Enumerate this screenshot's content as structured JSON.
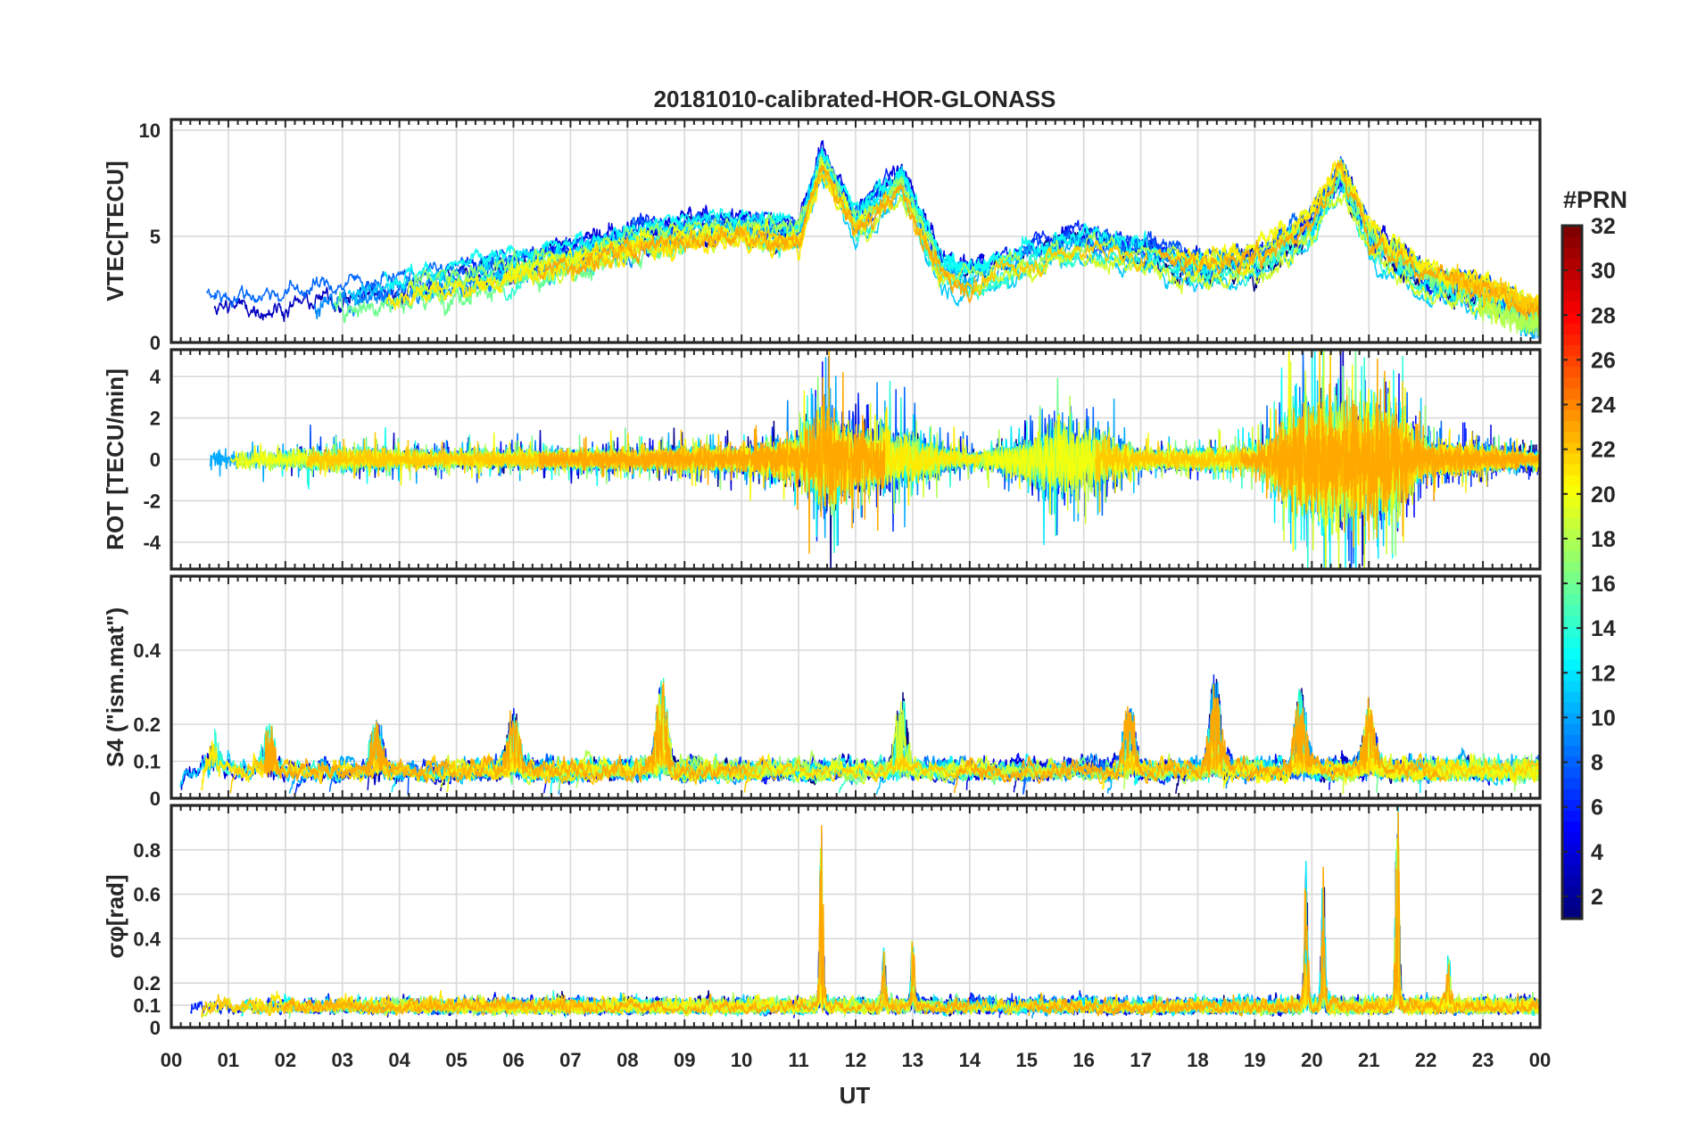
{
  "title": "20181010-calibrated-HOR-GLONASS",
  "chart_data": {
    "type": "line",
    "title": "20181010-calibrated-HOR-GLONASS",
    "xlabel": "UT",
    "xlim": [
      0,
      24
    ],
    "x_tick_labels": [
      "00",
      "01",
      "02",
      "03",
      "04",
      "05",
      "06",
      "07",
      "08",
      "09",
      "10",
      "11",
      "12",
      "13",
      "14",
      "15",
      "16",
      "17",
      "18",
      "19",
      "20",
      "21",
      "22",
      "23",
      "00"
    ],
    "grid": true,
    "colorbar": {
      "label": "#PRN",
      "colormap": "jet",
      "range": [
        1,
        32
      ],
      "tick_values": [
        2,
        4,
        6,
        8,
        10,
        12,
        14,
        16,
        18,
        20,
        22,
        24,
        26,
        28,
        30,
        32
      ],
      "tick_labels": [
        "2",
        "4",
        "6",
        "8",
        "10",
        "12",
        "14",
        "16",
        "18",
        "20",
        "22",
        "24",
        "26",
        "28",
        "30",
        "32"
      ]
    },
    "panels": [
      {
        "id": "vtec",
        "ylabel": "VTEC[TECU]",
        "ylim": [
          0,
          10.5
        ],
        "y_ticks": [
          0,
          5,
          10
        ],
        "y_tick_labels": [
          "0",
          "5",
          "10"
        ],
        "series_envelope": [
          {
            "x": 0,
            "y": 2.0
          },
          {
            "x": 1,
            "y": 1.8
          },
          {
            "x": 2,
            "y": 1.9
          },
          {
            "x": 3,
            "y": 2.3
          },
          {
            "x": 4,
            "y": 2.6
          },
          {
            "x": 5,
            "y": 3.0
          },
          {
            "x": 6,
            "y": 3.4
          },
          {
            "x": 7,
            "y": 4.0
          },
          {
            "x": 8,
            "y": 4.7
          },
          {
            "x": 9,
            "y": 5.2
          },
          {
            "x": 10,
            "y": 5.3
          },
          {
            "x": 11,
            "y": 5.0
          },
          {
            "x": 11.4,
            "y": 8.5
          },
          {
            "x": 12,
            "y": 5.5
          },
          {
            "x": 12.8,
            "y": 7.5
          },
          {
            "x": 13.5,
            "y": 3.4
          },
          {
            "x": 14,
            "y": 3.0
          },
          {
            "x": 15,
            "y": 4.0
          },
          {
            "x": 16,
            "y": 4.8
          },
          {
            "x": 17,
            "y": 4.2
          },
          {
            "x": 18,
            "y": 3.5
          },
          {
            "x": 19,
            "y": 3.8
          },
          {
            "x": 20,
            "y": 5.5
          },
          {
            "x": 20.5,
            "y": 8.0
          },
          {
            "x": 21,
            "y": 5.0
          },
          {
            "x": 22,
            "y": 3.0
          },
          {
            "x": 23,
            "y": 2.3
          },
          {
            "x": 24,
            "y": 1.3
          }
        ]
      },
      {
        "id": "rot",
        "ylabel": "ROT [TECU/min]",
        "ylim": [
          -5.3,
          5.3
        ],
        "y_ticks": [
          -4,
          -2,
          0,
          2,
          4
        ],
        "y_tick_labels": [
          "-4",
          "-2",
          "0",
          "2",
          "4"
        ],
        "activity_amplitude": [
          {
            "x": 0,
            "y": 0.6
          },
          {
            "x": 3,
            "y": 0.7
          },
          {
            "x": 5,
            "y": 0.5
          },
          {
            "x": 8,
            "y": 0.6
          },
          {
            "x": 10,
            "y": 0.8
          },
          {
            "x": 11,
            "y": 1.5
          },
          {
            "x": 11.5,
            "y": 3.5
          },
          {
            "x": 12,
            "y": 2.0
          },
          {
            "x": 13,
            "y": 1.5
          },
          {
            "x": 14,
            "y": 0.4
          },
          {
            "x": 15,
            "y": 1.2
          },
          {
            "x": 15.5,
            "y": 2.5
          },
          {
            "x": 16,
            "y": 1.8
          },
          {
            "x": 17,
            "y": 0.6
          },
          {
            "x": 19,
            "y": 0.7
          },
          {
            "x": 20,
            "y": 3.8
          },
          {
            "x": 21,
            "y": 3.5
          },
          {
            "x": 21.5,
            "y": 3.0
          },
          {
            "x": 22,
            "y": 1.0
          },
          {
            "x": 24,
            "y": 0.4
          }
        ]
      },
      {
        "id": "s4",
        "ylabel": "S4 (\"ism.mat\")",
        "ylim": [
          0,
          0.6
        ],
        "y_ticks": [
          0,
          0.1,
          0.2,
          0.4
        ],
        "y_tick_labels": [
          "0",
          "0.1",
          "0.2",
          "0.4"
        ],
        "peaks": [
          {
            "x": 0.7,
            "y": 0.25
          },
          {
            "x": 1.7,
            "y": 0.17
          },
          {
            "x": 3.6,
            "y": 0.15
          },
          {
            "x": 6.0,
            "y": 0.17
          },
          {
            "x": 8.6,
            "y": 0.25
          },
          {
            "x": 12.8,
            "y": 0.21
          },
          {
            "x": 16.8,
            "y": 0.19
          },
          {
            "x": 18.3,
            "y": 0.26
          },
          {
            "x": 19.8,
            "y": 0.23
          },
          {
            "x": 21.0,
            "y": 0.18
          }
        ]
      },
      {
        "id": "sigma_phi",
        "ylabel": "σφ[rad]",
        "ylim": [
          0,
          1.0
        ],
        "y_ticks": [
          0,
          0.1,
          0.2,
          0.4,
          0.6,
          0.8
        ],
        "y_tick_labels": [
          "0",
          "0.1",
          "0.2",
          "0.4",
          "0.6",
          "0.8"
        ],
        "peaks": [
          {
            "x": 11.4,
            "y": 0.82
          },
          {
            "x": 12.5,
            "y": 0.3
          },
          {
            "x": 13.0,
            "y": 0.32
          },
          {
            "x": 19.9,
            "y": 0.63
          },
          {
            "x": 20.2,
            "y": 0.69
          },
          {
            "x": 21.5,
            "y": 1.0
          },
          {
            "x": 22.4,
            "y": 0.26
          }
        ]
      }
    ]
  }
}
